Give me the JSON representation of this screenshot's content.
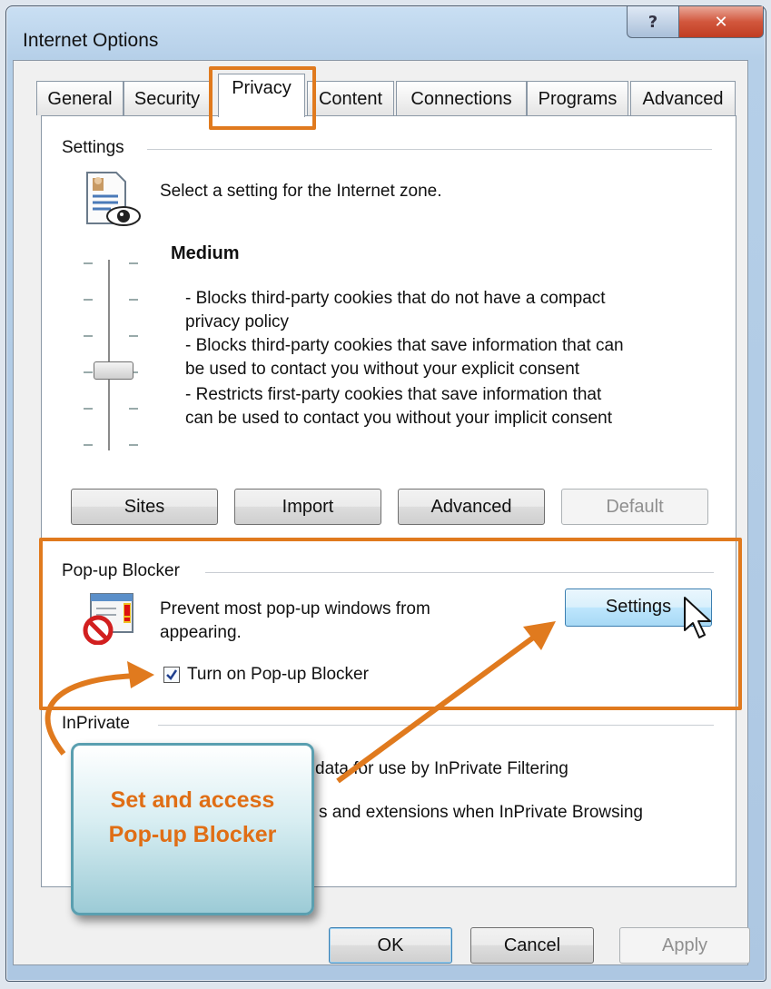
{
  "window": {
    "title": "Internet Options",
    "help_label": "?",
    "close_label": "✕"
  },
  "tabs": [
    {
      "label": "General"
    },
    {
      "label": "Security"
    },
    {
      "label": "Privacy"
    },
    {
      "label": "Content"
    },
    {
      "label": "Connections"
    },
    {
      "label": "Programs"
    },
    {
      "label": "Advanced"
    }
  ],
  "settings": {
    "group_label": "Settings",
    "description": "Select a setting for the Internet zone.",
    "level": "Medium",
    "details": [
      "- Blocks third-party cookies that do not have a compact",
      "privacy policy",
      "- Blocks third-party cookies that save information that can",
      "be used to contact you without your explicit consent",
      "- Restricts first-party cookies that save information that",
      "can be used to contact you without your implicit consent"
    ],
    "buttons": {
      "sites": "Sites",
      "import": "Import",
      "advanced": "Advanced",
      "default": "Default"
    }
  },
  "popup_blocker": {
    "group_label": "Pop-up Blocker",
    "description_line1": "Prevent most pop-up windows from",
    "description_line2": "appearing.",
    "settings_button": "Settings",
    "checkbox_label": "Turn on Pop-up Blocker",
    "checkbox_checked": true
  },
  "inprivate": {
    "group_label": "InPrivate",
    "line1_visible": "data for use by InPrivate Filtering",
    "line2_visible": "s and extensions when InPrivate Browsing"
  },
  "callout": {
    "line1": "Set and access",
    "line2": "Pop-up Blocker"
  },
  "footer": {
    "ok": "OK",
    "cancel": "Cancel",
    "apply": "Apply"
  },
  "colors": {
    "highlight": "#e07a1e",
    "callout_text": "#e06e15"
  }
}
